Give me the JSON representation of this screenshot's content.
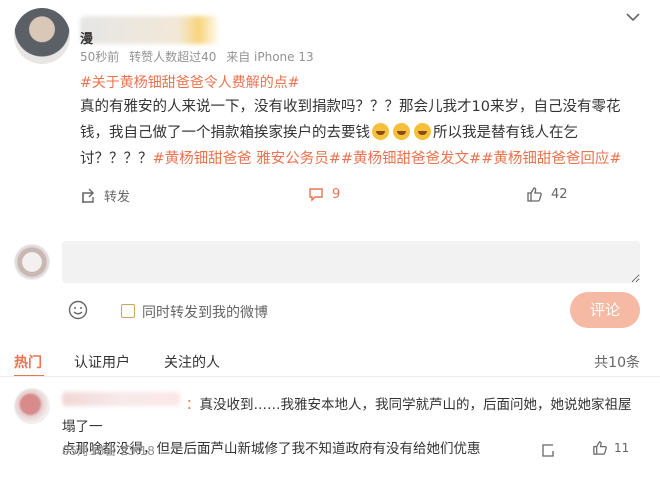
{
  "post": {
    "username": "漫",
    "meta": {
      "time": "50秒前",
      "likes_info": "转赞人数超过40",
      "source": "来自 iPhone 13"
    },
    "topic": "#关于黄杨钿甜爸爸令人费解的点#",
    "content": {
      "line1": "真的有雅安的人来说一下，没有收到捐款吗？？？那会儿我才10来岁，自己没有零花",
      "line2a": "钱，我自己做了一个捐款箱挨家挨户的去要钱",
      "line2b": "所以我是替有钱人在乞",
      "line3a": "讨？？？？",
      "hashtags": "#黄杨钿甜爸爸 雅安公务员##黄杨钿甜爸爸发文##黄杨钿甜爸爸回应#"
    },
    "actions": {
      "forward_label": "转发",
      "comment_count": "9",
      "like_count": "42"
    }
  },
  "reply": {
    "placeholder": "",
    "checkbox_label": "同时转发到我的微博",
    "submit_label": "评论"
  },
  "tabs": {
    "hot": "热门",
    "certified": "认证用户",
    "following": "关注的人",
    "total": "共10条"
  },
  "comment": {
    "author_suffix": "：",
    "text_line1": "真没收到……我雅安本地人，我同学就芦山的，后面问她，她说她家祖屋塌了一",
    "text_line2": "点那啥都没得，但是后面芦山新城修了我不知道政府有没有给她们优惠",
    "time": "05月18日 23:18",
    "like_count": "11"
  },
  "colors": {
    "accent": "#eb7350",
    "muted": "#939393",
    "submit_bg": "#f6b9a3"
  },
  "icons": [
    "more-icon",
    "forward-icon",
    "comment-icon",
    "like-icon",
    "smile-icon",
    "share-icon",
    "laugh-cry-emoji"
  ]
}
